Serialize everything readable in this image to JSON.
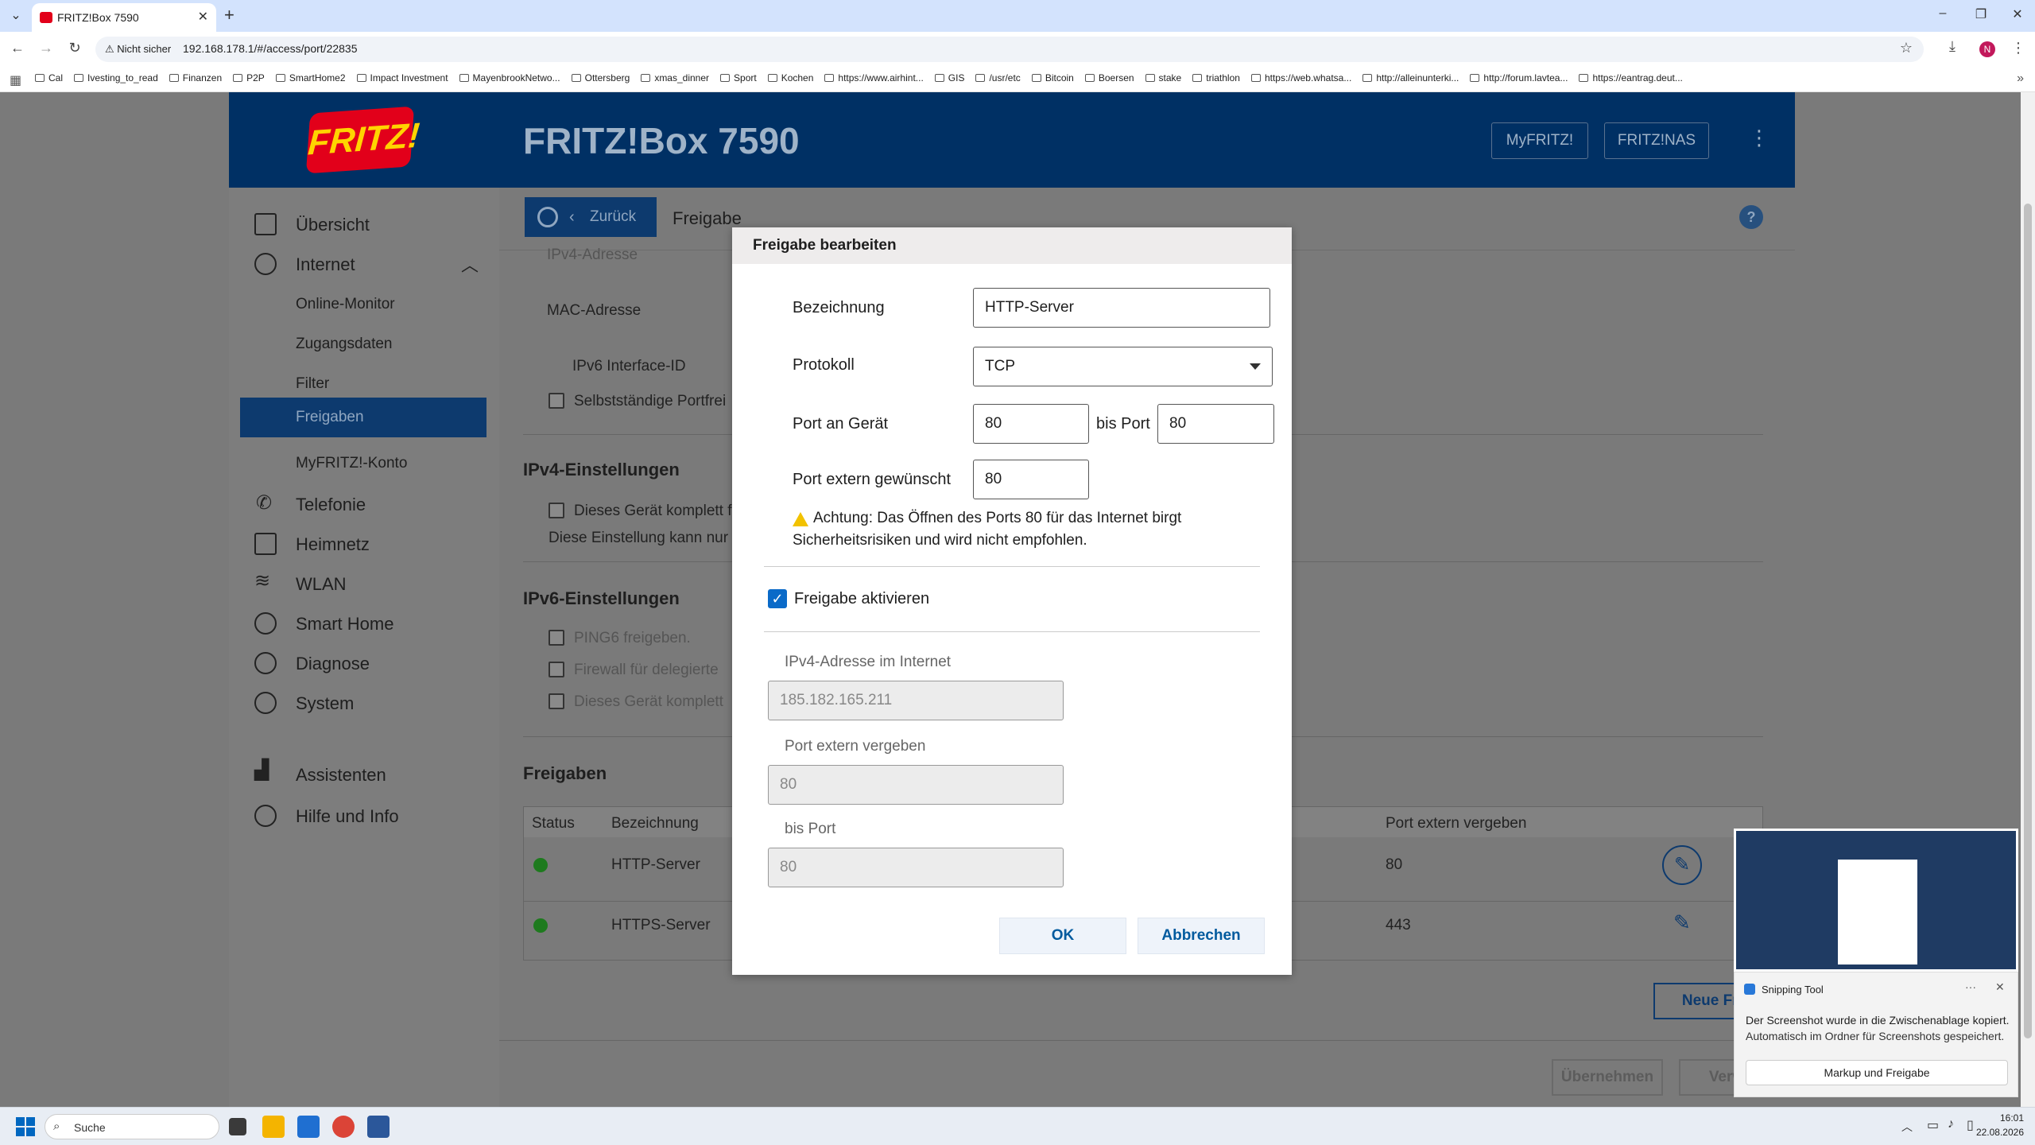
{
  "browser": {
    "tab_title": "FRITZ!Box 7590",
    "new_tab_label": "+",
    "not_secure_label": "Nicht sicher",
    "url": "192.168.178.1/#/access/port/22835",
    "profile_initial": "N",
    "bookmarks": [
      "Cal",
      "Ivesting_to_read",
      "Finanzen",
      "P2P",
      "SmartHome2",
      "Impact Investment",
      "MayenbrookNetwo...",
      "Ottersberg",
      "xmas_dinner",
      "Sport",
      "Kochen",
      "https://www.airhint...",
      "GIS",
      "/usr/etc",
      "Bitcoin",
      "Boersen",
      "stake",
      "triathlon",
      "https://web.whatsa...",
      "http://alleinunterki...",
      "http://forum.lavtea...",
      "https://eantrag.deut..."
    ]
  },
  "header": {
    "logo_text": "FRITZ!",
    "title": "FRITZ!Box 7590",
    "myfritz_label": "MyFRITZ!",
    "fritznas_label": "FRITZ!NAS"
  },
  "sidebar": {
    "items": [
      {
        "label": "Übersicht"
      },
      {
        "label": "Internet"
      },
      {
        "label": "Online-Monitor"
      },
      {
        "label": "Zugangsdaten"
      },
      {
        "label": "Filter"
      },
      {
        "label": "Freigaben"
      },
      {
        "label": "MyFRITZ!-Konto"
      },
      {
        "label": "Telefonie"
      },
      {
        "label": "Heimnetz"
      },
      {
        "label": "WLAN"
      },
      {
        "label": "Smart Home"
      },
      {
        "label": "Diagnose"
      },
      {
        "label": "System"
      },
      {
        "label": "Assistenten"
      },
      {
        "label": "Hilfe und Info"
      }
    ]
  },
  "content": {
    "back_label": "Zurück",
    "crumb": "Freigabe",
    "help_label": "?",
    "ipv4_addr_label": "IPv4-Adresse",
    "mac_label": "MAC-Adresse",
    "ipv6_iface_label": "IPv6 Interface-ID",
    "self_port_label": "Selbstständige Portfrei",
    "ipv4_settings_heading": "IPv4-Einstellungen",
    "ipv4_exposed_label": "Dieses Gerät komplett f",
    "ipv4_note": "Diese Einstellung kann nur f",
    "ipv6_settings_heading": "IPv6-Einstellungen",
    "ping6_label": "PING6 freigeben.",
    "firewall_label": "Firewall für delegierte",
    "ipv6_exposed_label": "Dieses Gerät komplett",
    "freigaben_heading": "Freigaben",
    "table_headers": [
      "Status",
      "Bezeichnung",
      "Port extern vergeben"
    ],
    "rows": [
      {
        "name": "HTTP-Server",
        "port": "80"
      },
      {
        "name": "HTTPS-Server",
        "port": "443"
      }
    ],
    "new_button": "Neue Freig",
    "apply_button": "Übernehmen",
    "discard_button": "Verw"
  },
  "modal": {
    "title": "Freigabe bearbeiten",
    "name_label": "Bezeichnung",
    "name_value": "HTTP-Server",
    "protocol_label": "Protokoll",
    "protocol_value": "TCP",
    "port_device_label": "Port an Gerät",
    "port_device_value": "80",
    "to_port_label": "bis Port",
    "to_port_value": "80",
    "ext_port_wish_label": "Port extern gewünscht",
    "ext_port_wish_value": "80",
    "warning": "Achtung: Das Öffnen des Ports 80 für das Internet birgt Sicherheitsrisiken und wird nicht empfohlen.",
    "activate_label": "Freigabe aktivieren",
    "activate_checked": true,
    "ipv4_internet_label": "IPv4-Adresse im Internet",
    "ipv4_internet_value": "185.182.165.211",
    "ext_port_assigned_label": "Port extern vergeben",
    "ext_port_assigned_value": "80",
    "bis_port_label": "bis Port",
    "bis_port_value": "80",
    "ok_label": "OK",
    "cancel_label": "Abbrechen"
  },
  "snipping": {
    "app_name": "Snipping Tool",
    "message": "Der Screenshot wurde in die Zwischenablage kopiert.",
    "sub_message": "Automatisch im Ordner für Screenshots gespeichert.",
    "button_label": "Markup und Freigabe"
  },
  "taskbar": {
    "search_label": "Suche",
    "time": "16:01",
    "date": "22.08.2026"
  },
  "colors": {
    "fritz_blue": "#003064",
    "active_nav": "#0d3a6e",
    "checkbox_blue": "#0a6ac8",
    "status_green": "#1e7a1e",
    "warning_yellow": "#f2c200"
  }
}
